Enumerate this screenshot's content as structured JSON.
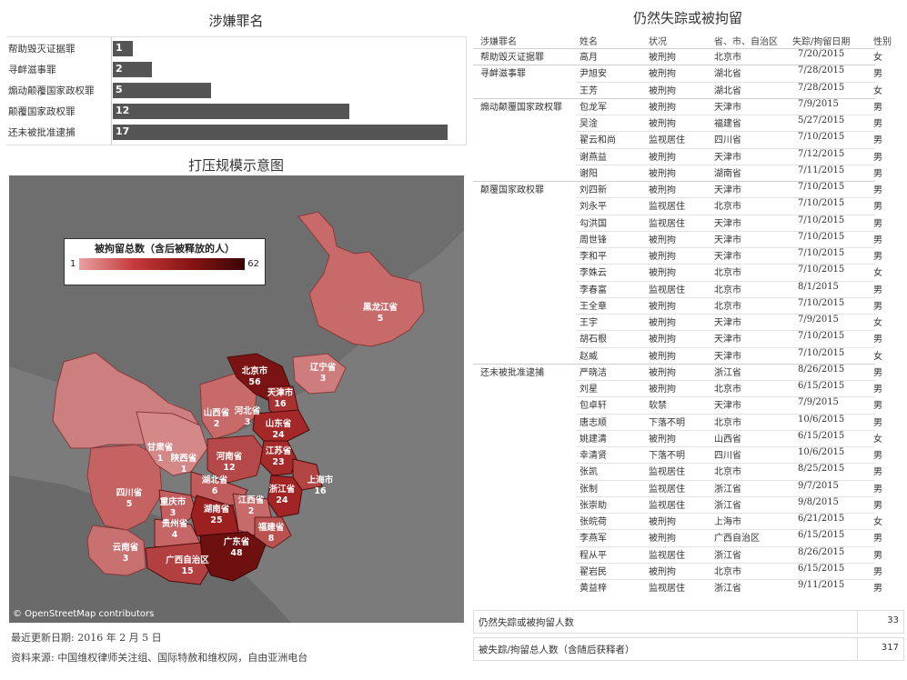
{
  "crime_title": "涉嫌罪名",
  "map_title": "打压规模示意图",
  "table_title": "仍然失踪或被拘留",
  "chart_data": {
    "type": "bar",
    "title": "涉嫌罪名",
    "categories": [
      "帮助毁灭证据罪",
      "寻衅滋事罪",
      "煽动颠覆国家政权罪",
      "颠覆国家政权罪",
      "还未被批准逮捕"
    ],
    "values": [
      1,
      2,
      5,
      12,
      17
    ],
    "xlim": [
      0,
      17
    ],
    "orientation": "horizontal",
    "bar_color": "#555555"
  },
  "map": {
    "legend_title": "被拘留总数（含后被释放的人）",
    "legend_min": "1",
    "legend_max": "62",
    "attribution": "© OpenStreetMap contributors",
    "provinces": [
      {
        "name": "黑龙江省",
        "value": "5"
      },
      {
        "name": "北京市",
        "value": "56"
      },
      {
        "name": "辽宁省",
        "value": "3"
      },
      {
        "name": "天津市",
        "value": "16"
      },
      {
        "name": "河北省",
        "value": "3"
      },
      {
        "name": "山西省",
        "value": "2"
      },
      {
        "name": "山东省",
        "value": "24"
      },
      {
        "name": "甘肃省",
        "value": "1"
      },
      {
        "name": "陕西省",
        "value": "1"
      },
      {
        "name": "河南省",
        "value": "12"
      },
      {
        "name": "江苏省",
        "value": "23"
      },
      {
        "name": "上海市",
        "value": "16"
      },
      {
        "name": "湖北省",
        "value": "6"
      },
      {
        "name": "四川省",
        "value": "5"
      },
      {
        "name": "浙江省",
        "value": "24"
      },
      {
        "name": "重庆市",
        "value": "3"
      },
      {
        "name": "江西省",
        "value": "2"
      },
      {
        "name": "湖南省",
        "value": "25"
      },
      {
        "name": "贵州省",
        "value": "4"
      },
      {
        "name": "福建省",
        "value": "8"
      },
      {
        "name": "云南省",
        "value": "3"
      },
      {
        "name": "广东省",
        "value": "48"
      },
      {
        "name": "广西自治区",
        "value": "15"
      }
    ]
  },
  "footer": {
    "updated": "最近更新日期: 2016 年 2 月 5 日",
    "source": "资料来源: 中国维权律师关注组、国际特赦和维权网，自由亚洲电台"
  },
  "table": {
    "headers": [
      "涉嫌罪名",
      "姓名",
      "状况",
      "省、市、自治区",
      "失踪/拘留日期",
      "性别"
    ],
    "groups": [
      {
        "crime": "帮助毁灭证据罪",
        "rows": [
          [
            "高月",
            "被刑拘",
            "北京市",
            "7/20/2015",
            "女"
          ]
        ]
      },
      {
        "crime": "寻衅滋事罪",
        "rows": [
          [
            "尹旭安",
            "被刑拘",
            "湖北省",
            "7/28/2015",
            "男"
          ],
          [
            "王芳",
            "被刑拘",
            "湖北省",
            "7/28/2015",
            "女"
          ]
        ]
      },
      {
        "crime": "煽动颠覆国家政权罪",
        "rows": [
          [
            "包龙军",
            "被刑拘",
            "天津市",
            "7/9/2015",
            "男"
          ],
          [
            "吴淦",
            "被刑拘",
            "福建省",
            "5/27/2015",
            "男"
          ],
          [
            "翟云和尚",
            "监视居住",
            "四川省",
            "7/10/2015",
            "男"
          ],
          [
            "谢燕益",
            "被刑拘",
            "天津市",
            "7/12/2015",
            "男"
          ],
          [
            "谢阳",
            "被刑拘",
            "湖南省",
            "7/11/2015",
            "男"
          ]
        ]
      },
      {
        "crime": "颠覆国家政权罪",
        "rows": [
          [
            "刘四新",
            "被刑拘",
            "天津市",
            "7/10/2015",
            "男"
          ],
          [
            "刘永平",
            "监视居住",
            "北京市",
            "7/10/2015",
            "男"
          ],
          [
            "勾洪国",
            "监视居住",
            "天津市",
            "7/10/2015",
            "男"
          ],
          [
            "周世锋",
            "被刑拘",
            "天津市",
            "7/10/2015",
            "男"
          ],
          [
            "李和平",
            "被刑拘",
            "天津市",
            "7/10/2015",
            "男"
          ],
          [
            "李姝云",
            "被刑拘",
            "北京市",
            "7/10/2015",
            "女"
          ],
          [
            "李春富",
            "监视居住",
            "北京市",
            "8/1/2015",
            "男"
          ],
          [
            "王全章",
            "被刑拘",
            "北京市",
            "7/10/2015",
            "男"
          ],
          [
            "王宇",
            "被刑拘",
            "天津市",
            "7/9/2015",
            "女"
          ],
          [
            "胡石根",
            "被刑拘",
            "天津市",
            "7/10/2015",
            "男"
          ],
          [
            "赵威",
            "被刑拘",
            "天津市",
            "7/10/2015",
            "女"
          ]
        ]
      },
      {
        "crime": "还未被批准逮捕",
        "rows": [
          [
            "严晓洁",
            "被刑拘",
            "浙江省",
            "8/26/2015",
            "男"
          ],
          [
            "刘星",
            "被刑拘",
            "北京市",
            "6/15/2015",
            "男"
          ],
          [
            "包卓轩",
            "软禁",
            "天津市",
            "7/9/2015",
            "男"
          ],
          [
            "唐志顺",
            "下落不明",
            "北京市",
            "10/6/2015",
            "男"
          ],
          [
            "姚建清",
            "被刑拘",
            "山西省",
            "6/15/2015",
            "女"
          ],
          [
            "幸清贤",
            "下落不明",
            "四川省",
            "10/6/2015",
            "男"
          ],
          [
            "张凯",
            "监视居住",
            "北京市",
            "8/25/2015",
            "男"
          ],
          [
            "张制",
            "监视居住",
            "浙江省",
            "9/7/2015",
            "男"
          ],
          [
            "张崇助",
            "监视居住",
            "浙江省",
            "9/8/2015",
            "男"
          ],
          [
            "张皖荷",
            "被刑拘",
            "上海市",
            "6/21/2015",
            "女"
          ],
          [
            "李燕军",
            "被刑拘",
            "广西自治区",
            "6/15/2015",
            "男"
          ],
          [
            "程从平",
            "监视居住",
            "浙江省",
            "8/26/2015",
            "男"
          ],
          [
            "翟岩民",
            "被刑拘",
            "北京市",
            "6/15/2015",
            "男"
          ],
          [
            "黄益梓",
            "监视居住",
            "浙江省",
            "9/11/2015",
            "男"
          ]
        ]
      }
    ]
  },
  "summary": {
    "still_label": "仍然失踪或被拘留人数",
    "still_value": "33",
    "total_label": "被失踪/拘留总人数（含随后获释者）",
    "total_value": "317"
  }
}
